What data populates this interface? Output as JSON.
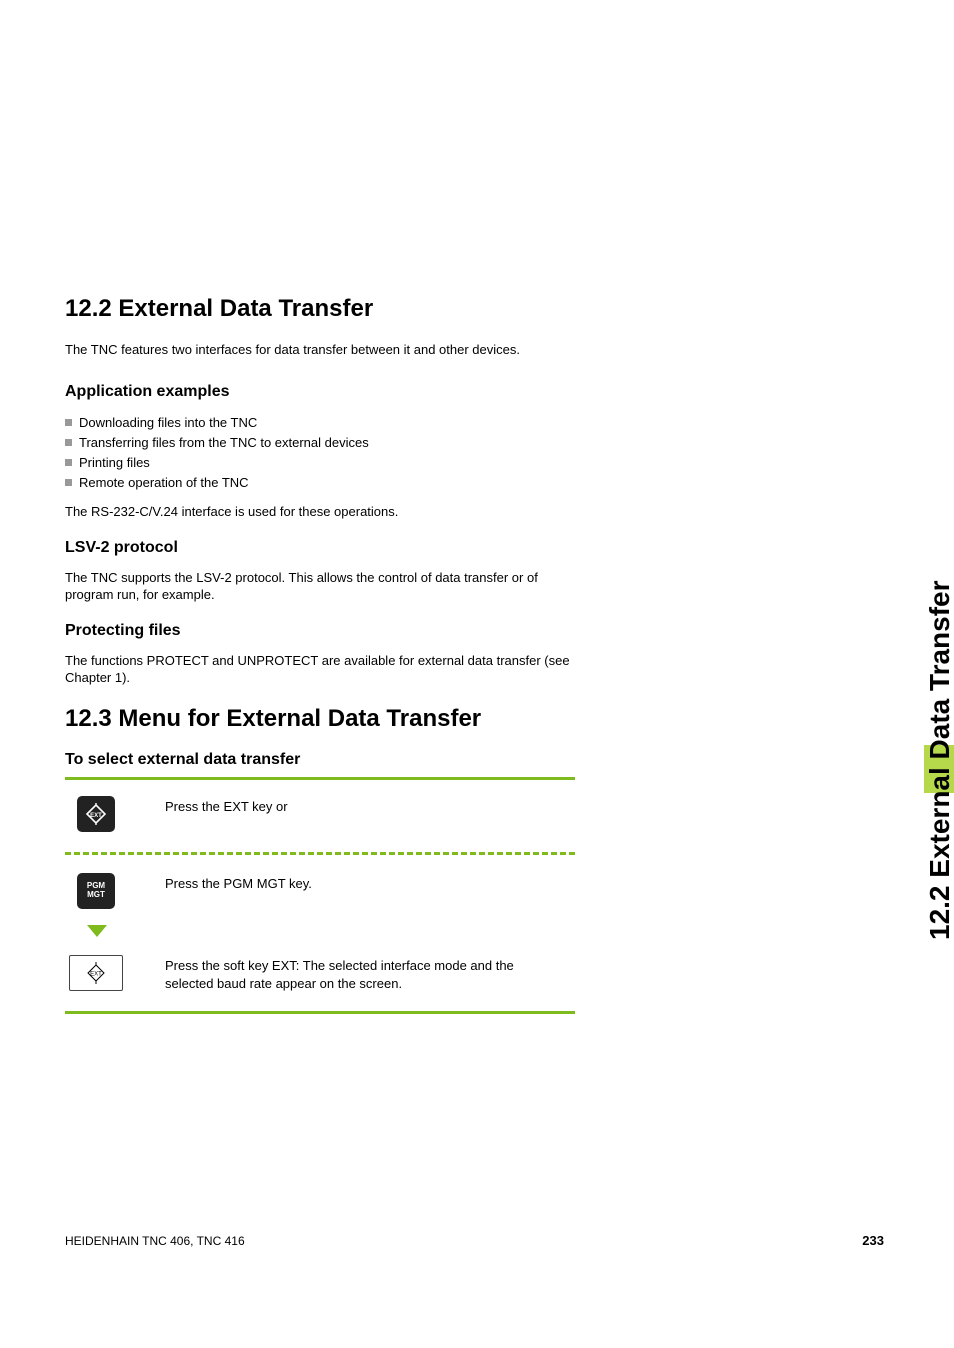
{
  "side_title": "12.2 External Data Transfer",
  "section_12_2": {
    "heading": "12.2 External Data Transfer",
    "intro": "The TNC features two interfaces for data transfer between it and other devices.",
    "app_examples_heading": "Application examples",
    "bullets": [
      "Downloading files into the TNC",
      "Transferring files from the TNC to external devices",
      "Printing files",
      "Remote operation of the TNC"
    ],
    "rs232_note": "The RS-232-C/V.24 interface is used for these operations.",
    "lsv2_heading": "LSV-2 protocol",
    "lsv2_body": "The TNC supports the LSV-2 protocol. This allows the control of data transfer or of program run, for example.",
    "protect_heading": "Protecting files",
    "protect_body": "The functions PROTECT and UNPROTECT are available for external data transfer (see Chapter 1)."
  },
  "section_12_3": {
    "heading": "12.3 Menu for External Data Transfer",
    "select_heading": "To select external data transfer",
    "step1": "Press the EXT key or",
    "step2": "Press the PGM MGT key.",
    "step3": "Press the soft key EXT: The selected interface mode and the selected baud rate appear on the screen.",
    "pgm_mgt_label_line1": "PGM",
    "pgm_mgt_label_line2": "MGT",
    "ext_label": "EXT"
  },
  "footer": {
    "left": "HEIDENHAIN TNC 406, TNC 416",
    "page": "233"
  }
}
